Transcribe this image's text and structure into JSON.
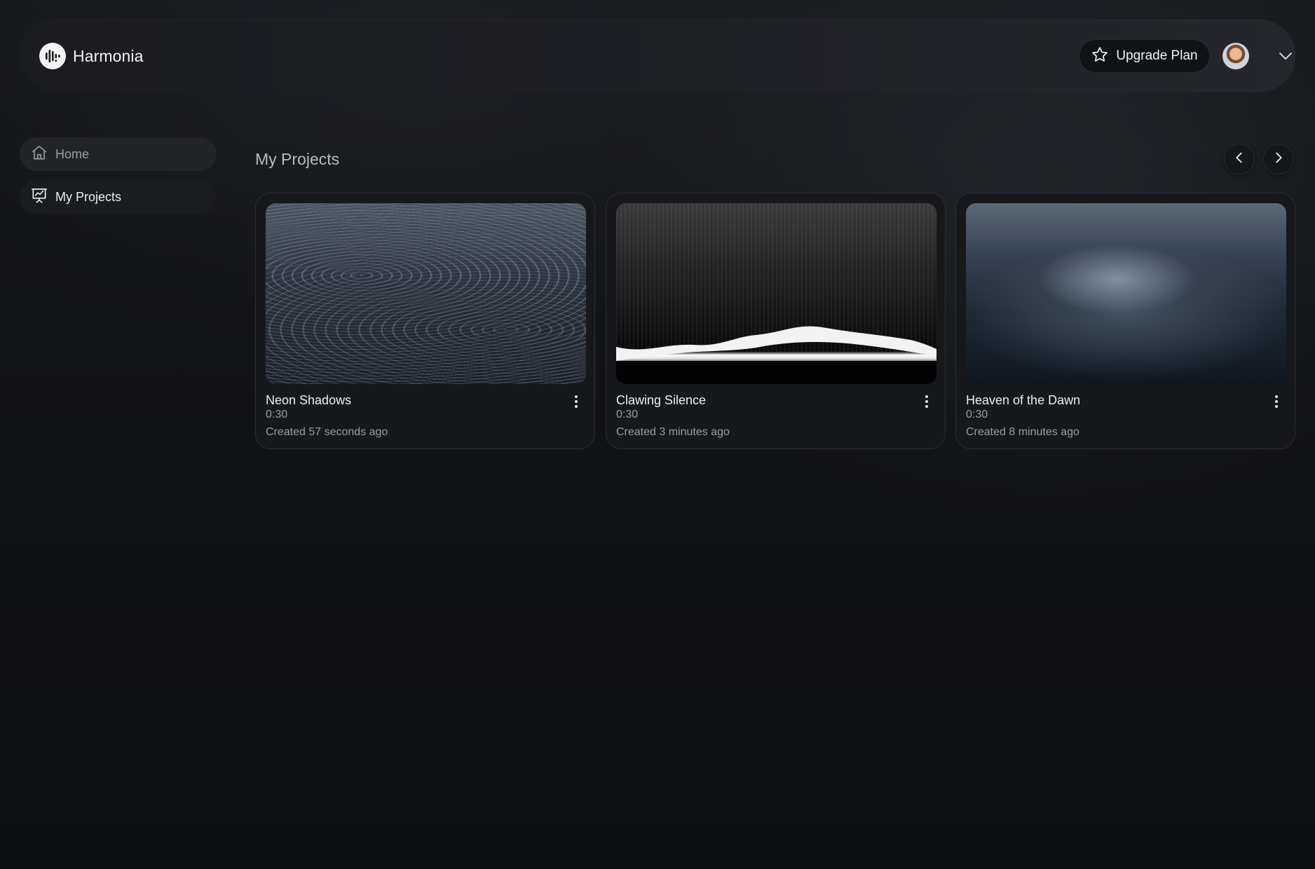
{
  "app": {
    "name": "Harmonia",
    "logo_icon": "waveform-icon"
  },
  "header": {
    "upgrade_label": "Upgrade Plan",
    "upgrade_icon": "star-icon",
    "avatar_menu_icon": "chevron-down-icon"
  },
  "sidebar": {
    "items": [
      {
        "label": "Home",
        "icon": "home-icon",
        "active": false
      },
      {
        "label": "My Projects",
        "icon": "presentation-chart-icon",
        "active": true
      }
    ]
  },
  "main": {
    "title": "My Projects",
    "prev_icon": "chevron-left-icon",
    "next_icon": "chevron-right-icon",
    "projects": [
      {
        "title": "Neon Shadows",
        "duration": "0:30",
        "created": "Created 57 seconds ago"
      },
      {
        "title": "Clawing Silence",
        "duration": "0:30",
        "created": "Created 3 minutes ago"
      },
      {
        "title": "Heaven of the Dawn",
        "duration": "0:30",
        "created": "Created 8 minutes ago"
      }
    ]
  },
  "colors": {
    "background": "#0f1013",
    "surface": "#17181c",
    "text_primary": "#eceef1",
    "text_secondary": "#9a9ca2"
  }
}
